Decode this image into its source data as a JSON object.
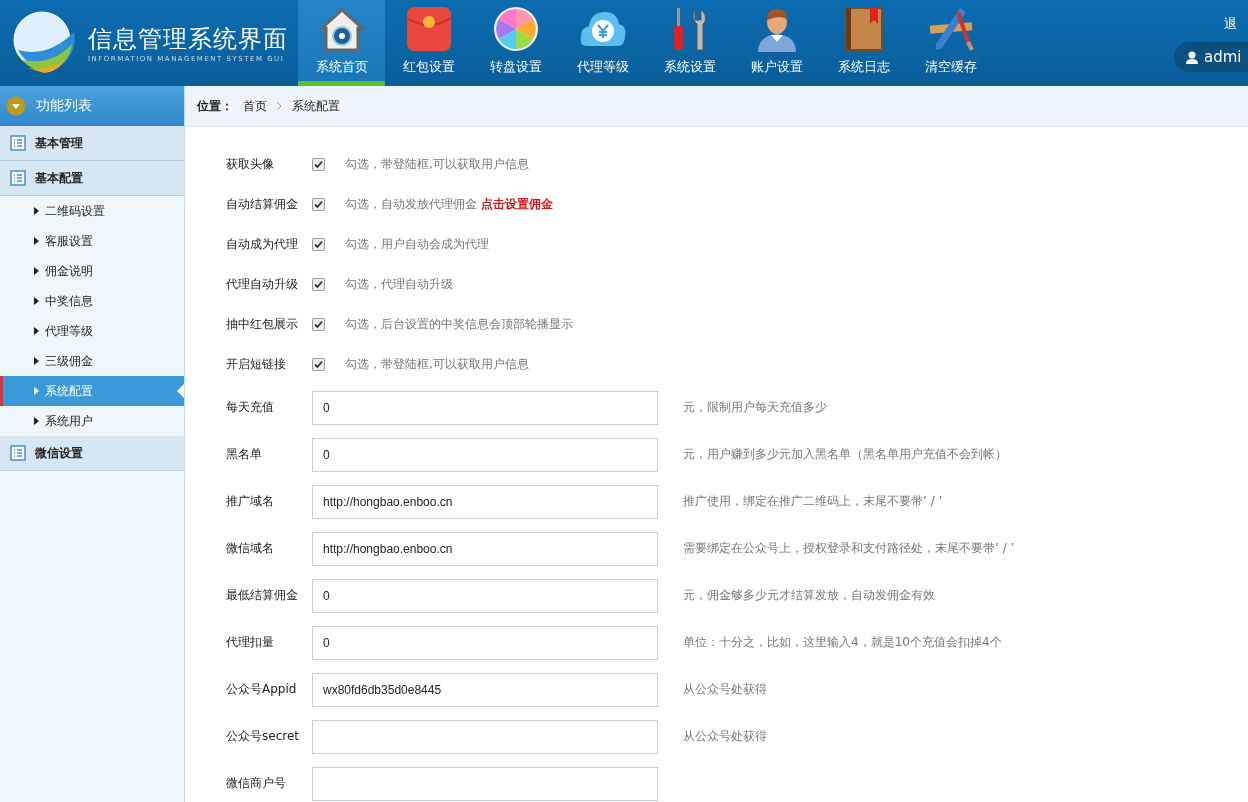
{
  "header": {
    "title": "信息管理系统界面",
    "subtitle": "INFORMATION MANAGEMENT SYSTEM GUI",
    "logout": "退",
    "user": "admi",
    "nav": [
      {
        "label": "系统首页",
        "selected": true
      },
      {
        "label": "红包设置",
        "selected": false
      },
      {
        "label": "转盘设置",
        "selected": false
      },
      {
        "label": "代理等级",
        "selected": false
      },
      {
        "label": "系统设置",
        "selected": false
      },
      {
        "label": "账户设置",
        "selected": false
      },
      {
        "label": "系统日志",
        "selected": false
      },
      {
        "label": "清空缓存",
        "selected": false
      }
    ]
  },
  "sidebar": {
    "title": "功能列表",
    "groups": [
      {
        "label": "基本管理"
      },
      {
        "label": "基本配置",
        "children": [
          {
            "label": "二维码设置",
            "selected": false
          },
          {
            "label": "客服设置",
            "selected": false
          },
          {
            "label": "佣金说明",
            "selected": false
          },
          {
            "label": "中奖信息",
            "selected": false
          },
          {
            "label": "代理等级",
            "selected": false
          },
          {
            "label": "三级佣金",
            "selected": false
          },
          {
            "label": "系统配置",
            "selected": true
          },
          {
            "label": "系统用户",
            "selected": false
          }
        ]
      },
      {
        "label": "微信设置"
      }
    ]
  },
  "breadcrumb": {
    "label": "位置：",
    "items": [
      "首页",
      "系统配置"
    ]
  },
  "form": {
    "rows": [
      {
        "kind": "checkbox",
        "label": "获取头像",
        "checked": true,
        "hint": "勾选，带登陆框,可以获取用户信息"
      },
      {
        "kind": "checkbox",
        "label": "自动结算佣金",
        "checked": true,
        "hint": "勾选，自动发放代理佣金",
        "link": "点击设置佣金"
      },
      {
        "kind": "checkbox",
        "label": "自动成为代理",
        "checked": true,
        "hint": "勾选，用户自动会成为代理"
      },
      {
        "kind": "checkbox",
        "label": "代理自动升级",
        "checked": true,
        "hint": "勾选，代理自动升级"
      },
      {
        "kind": "checkbox",
        "label": "抽中红包展示",
        "checked": true,
        "hint": "勾选，后台设置的中奖信息会顶部轮播显示"
      },
      {
        "kind": "checkbox",
        "label": "开启短链接",
        "checked": true,
        "hint": "勾选，带登陆框,可以获取用户信息"
      },
      {
        "kind": "input",
        "label": "每天充值",
        "value": "0",
        "hint": "元，限制用户每天充值多少"
      },
      {
        "kind": "input",
        "label": "黑名单",
        "value": "0",
        "hint": "元，用户赚到多少元加入黑名单（黑名单用户充值不会到帐）"
      },
      {
        "kind": "input",
        "label": "推广域名",
        "value": "http://hongbao.enboo.cn",
        "hint": "推广使用，绑定在推广二维码上，末尾不要带’ / ’"
      },
      {
        "kind": "input",
        "label": "微信域名",
        "value": "http://hongbao.enboo.cn",
        "hint": "需要绑定在公众号上，授权登录和支付路径处，末尾不要带’ / ’"
      },
      {
        "kind": "input",
        "label": "最低结算佣金",
        "value": "0",
        "hint": "元，佣金够多少元才结算发放，自动发佣金有效"
      },
      {
        "kind": "input",
        "label": "代理扣量",
        "value": "0",
        "hint": "单位：十分之，比如，这里输入4，就是10个充值会扣掉4个"
      },
      {
        "kind": "input",
        "label": "公众号Appid",
        "value": "wx80fd6db35d0e8445",
        "hint": "从公众号处获得"
      },
      {
        "kind": "input",
        "label": "公众号secret",
        "hint": "从公众号处获得"
      },
      {
        "kind": "input",
        "label": "微信商户号"
      }
    ]
  }
}
